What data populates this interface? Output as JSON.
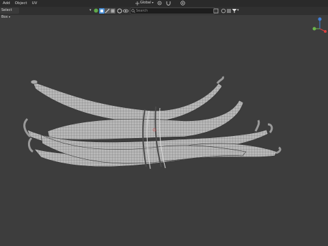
{
  "menubar": {
    "items": [
      "Add",
      "Object",
      "UV"
    ]
  },
  "header": {
    "select_mode_label": "Select Box",
    "transform_orientation": "Global",
    "search_placeholder": "Search"
  },
  "icons": {
    "cursor": "cursor-arrow-icon",
    "visibility": "eye-icon",
    "select_modes": [
      "vertex-select-icon",
      "edge-select-icon",
      "face-select-icon"
    ],
    "pivot": "pivot-point-icon",
    "snap": "snap-magnet-icon",
    "proportional": "proportional-edit-icon",
    "filter": "filter-funnel-icon"
  },
  "colors": {
    "background": "#3d3d3d",
    "menubar": "#2a2a2a",
    "toolbar": "#303030",
    "mesh_fill": "#b8b8b8",
    "wire": "#3a3a3a",
    "accent_blue": "#4a90d9",
    "gizmo_x": "#d94040",
    "gizmo_y": "#6bb54a",
    "gizmo_z": "#3f7fd9"
  },
  "viewport": {
    "object": "green-beans-bundle-mesh"
  }
}
